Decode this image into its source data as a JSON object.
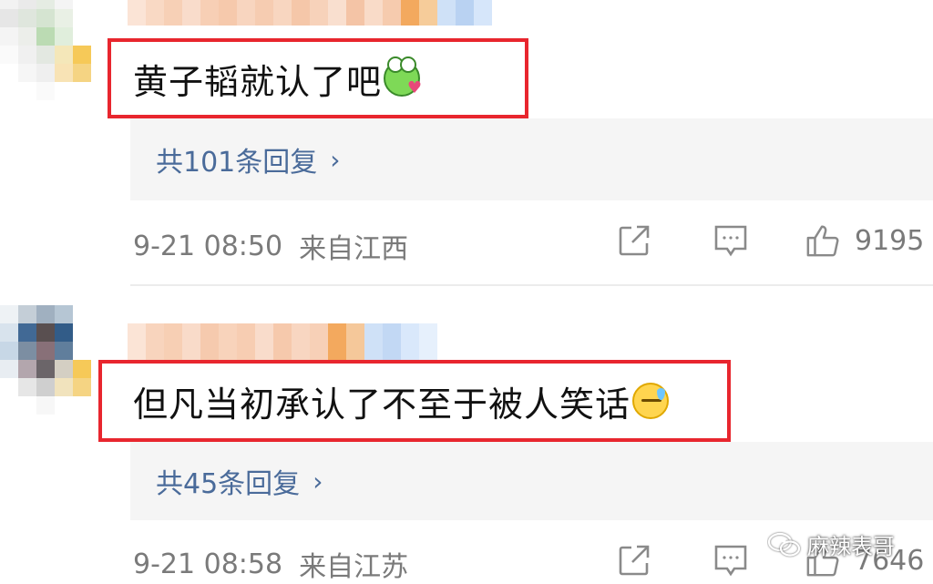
{
  "comments": [
    {
      "text": "黄子韬就认了吧",
      "emoji": "frog-heart-emoji",
      "replies_label": "共101条回复",
      "date": "9-21 08:50",
      "location": "来自江西",
      "likes": "9195"
    },
    {
      "text": "但凡当初承认了不至于被人笑话",
      "emoji": "sweat-emoji",
      "replies_label": "共45条回复",
      "date": "9-21 08:58",
      "location": "来自江苏",
      "likes": "7646"
    }
  ],
  "icons": {
    "chevron": "›",
    "share": "share-icon",
    "comment": "comment-icon",
    "like": "thumbs-up-icon"
  },
  "watermark": {
    "text": "麻辣表哥"
  },
  "colors": {
    "highlight_box": "#e8262e",
    "reply_link": "#4a6b9a",
    "meta_text": "#7a7a7a",
    "reply_bg": "#f5f5f5"
  }
}
